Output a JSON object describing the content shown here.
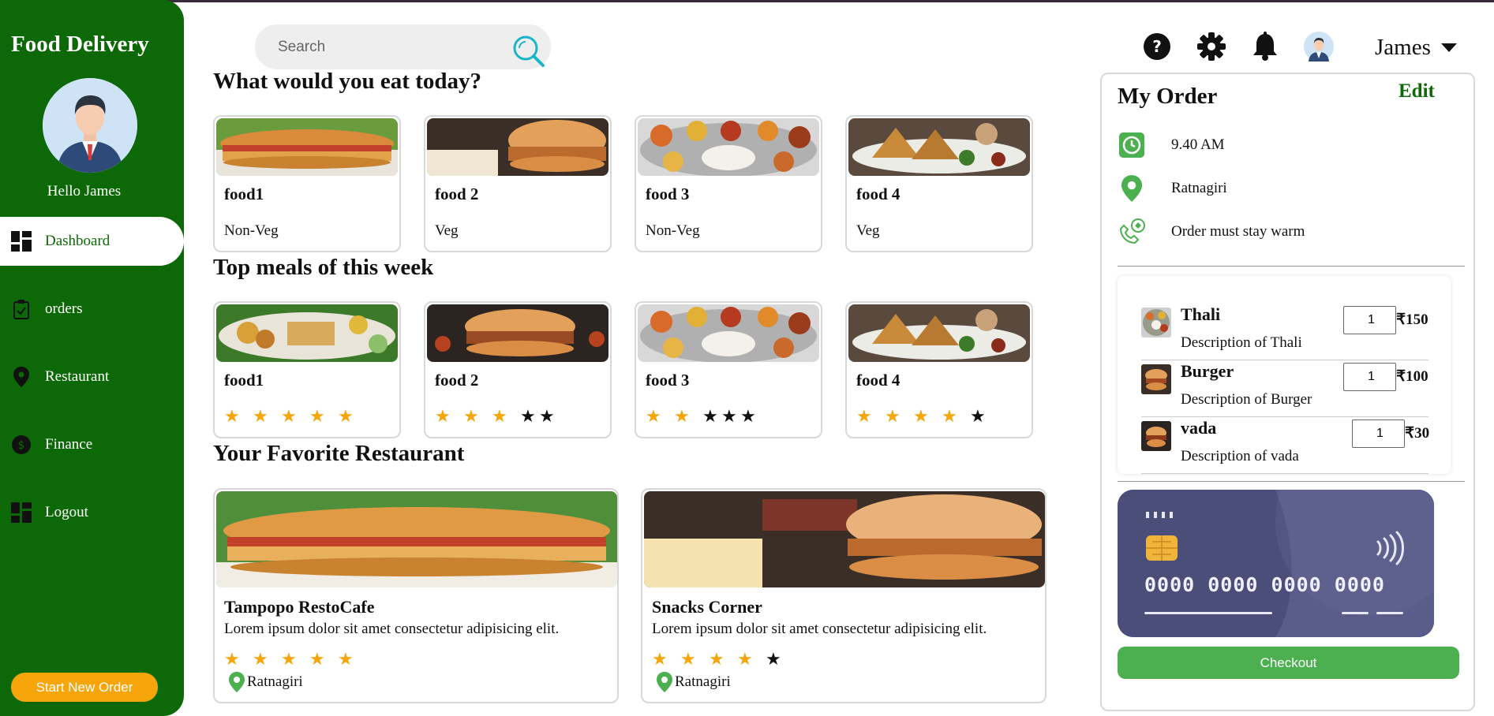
{
  "sidebar": {
    "brand": "Food Delivery",
    "greeting": "Hello James",
    "items": [
      {
        "label": "Dashboard",
        "icon": "dashboard-icon",
        "active": true
      },
      {
        "label": "orders",
        "icon": "clipboard-icon",
        "active": false
      },
      {
        "label": "Restaurant",
        "icon": "location-pin-icon",
        "active": false
      },
      {
        "label": "Finance",
        "icon": "dollar-circle-icon",
        "active": false
      },
      {
        "label": "Logout",
        "icon": "dashboard-icon",
        "active": false
      }
    ],
    "start_button": "Start New Order"
  },
  "header": {
    "search_placeholder": "Search",
    "user_name": "James"
  },
  "sections": {
    "eat_today": "What would you eat today?",
    "top_meals": "Top meals of this week",
    "favorite": "Your Favorite Restaurant"
  },
  "eat_today": [
    {
      "name": "food1",
      "type": "Non-Veg"
    },
    {
      "name": "food 2",
      "type": "Veg"
    },
    {
      "name": "food 3",
      "type": "Non-Veg"
    },
    {
      "name": "food 4",
      "type": "Veg"
    }
  ],
  "top_meals": [
    {
      "name": "food1",
      "rating": 5
    },
    {
      "name": "food 2",
      "rating": 3
    },
    {
      "name": "food 3",
      "rating": 2
    },
    {
      "name": "food 4",
      "rating": 4
    }
  ],
  "restaurants": [
    {
      "name": "Tampopo RestoCafe",
      "description": "Lorem ipsum dolor sit amet consectetur adipisicing elit.",
      "rating": 5,
      "location": "Ratnagiri"
    },
    {
      "name": "Snacks Corner",
      "description": "Lorem ipsum dolor sit amet consectetur adipisicing elit.",
      "rating": 4,
      "location": "Ratnagiri"
    }
  ],
  "order": {
    "title": "My Order",
    "edit_label": "Edit",
    "time": "9.40 AM",
    "location": "Ratnagiri",
    "note": "Order must stay warm",
    "items": [
      {
        "name": "Thali",
        "description": "Description of Thali",
        "qty": "1",
        "price": "₹150"
      },
      {
        "name": "Burger",
        "description": "Description of Burger",
        "qty": "1",
        "price": "₹100"
      },
      {
        "name": "vada",
        "description": "Description of vada",
        "qty": "1",
        "price": "₹30"
      }
    ],
    "card_number": "0000 0000 0000 0000",
    "checkout_label": "Checkout"
  },
  "colors": {
    "sidebar_green": "#0d6907",
    "accent_orange": "#f6a50b",
    "checkout_green": "#4caf50",
    "card_purple": "#4c4e7a"
  }
}
